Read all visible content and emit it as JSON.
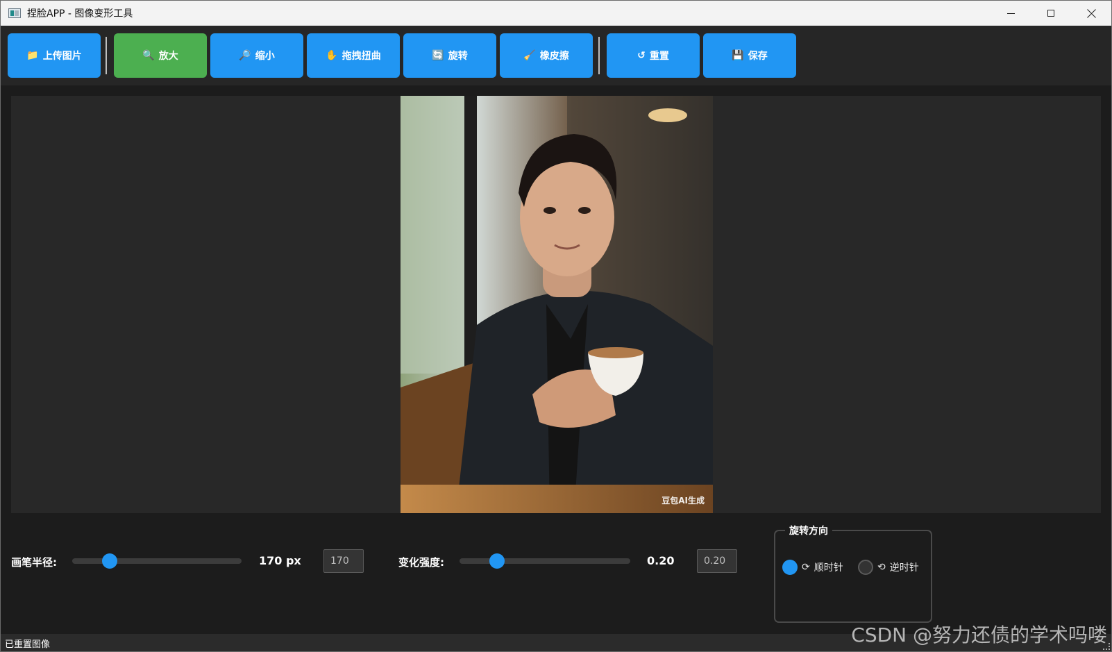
{
  "window": {
    "title": "捏脸APP - 图像变形工具",
    "controls": {
      "minimize": "minimize",
      "maximize": "maximize",
      "close": "close"
    }
  },
  "toolbar": {
    "buttons": [
      {
        "icon": "📁",
        "label": "上传图片",
        "active": false
      },
      {
        "icon": "🔍",
        "label": "放大",
        "active": true
      },
      {
        "icon": "🔎",
        "label": "缩小",
        "active": false
      },
      {
        "icon": "✋",
        "label": "拖拽扭曲",
        "active": false
      },
      {
        "icon": "🔄",
        "label": "旋转",
        "active": false
      },
      {
        "icon": "🧹",
        "label": "橡皮擦",
        "active": false
      },
      {
        "icon": "↺",
        "label": "重置",
        "active": false
      },
      {
        "icon": "💾",
        "label": "保存",
        "active": false
      }
    ]
  },
  "canvas": {
    "watermark": "豆包AI生成"
  },
  "brush": {
    "label": "画笔半径:",
    "value_text": "170 px",
    "field_value": "170",
    "slider_fraction": 0.22
  },
  "strength": {
    "label": "变化强度:",
    "value_text": "0.20",
    "field_value": "0.20",
    "slider_fraction": 0.22
  },
  "rotation": {
    "title": "旋转方向",
    "options": [
      {
        "icon": "⟳",
        "label": "顺时针",
        "checked": true
      },
      {
        "icon": "⟲",
        "label": "逆时针",
        "checked": false
      }
    ]
  },
  "status": {
    "text": "已重置图像",
    "overlay": "CSDN @努力还债的学术吗喽"
  },
  "colors": {
    "button_blue": "#2196f3",
    "button_active_green": "#4caf50",
    "background": "#1c1c1c"
  }
}
